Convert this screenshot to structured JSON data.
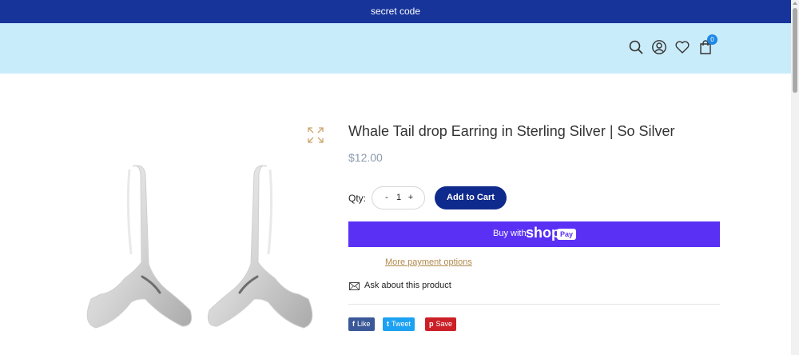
{
  "announcement": {
    "text": "secret code"
  },
  "header": {
    "icons": [
      "search-icon",
      "account-icon",
      "wishlist-icon",
      "cart-icon"
    ],
    "cart_count": "0"
  },
  "product": {
    "title": "Whale Tail drop Earring in Sterling Silver | So Silver",
    "price": "$12.00",
    "qty_label": "Qty:",
    "qty_value": "1",
    "qty_minus": "-",
    "qty_plus": "+",
    "add_to_cart": "Add to Cart",
    "shop_pay": {
      "prefix": "Buy with",
      "brand": "shop",
      "badge": "Pay"
    },
    "more_payment": "More payment options",
    "ask": "Ask about this product"
  },
  "share": [
    {
      "icon": "f",
      "label": "Like",
      "color": "#3b5998"
    },
    {
      "icon": "t",
      "label": "Tweet",
      "color": "#1da1f2"
    },
    {
      "icon": "p",
      "label": "Save",
      "color": "#cb2027"
    }
  ],
  "colors": {
    "announcement_bg": "#17349a",
    "header_bg": "#c9ecfb",
    "primary_button": "#0f2a8d",
    "shop_pay": "#5a31f4",
    "link": "#b08a4d"
  }
}
